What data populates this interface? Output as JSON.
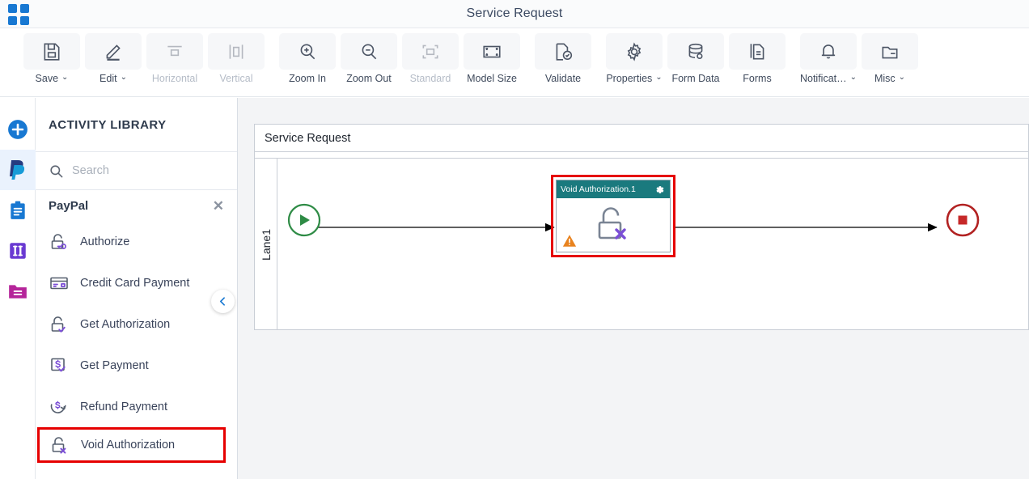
{
  "window": {
    "title": "Service Request",
    "app_icon": "grid-icon"
  },
  "toolbar": {
    "items": [
      {
        "label": "Save",
        "icon": "save-icon",
        "caret": "⌄",
        "disabled": false
      },
      {
        "label": "Edit",
        "icon": "pencil-icon",
        "caret": "⌄",
        "disabled": false
      },
      {
        "label": "Horizontal",
        "icon": "horizontal-icon",
        "caret": "",
        "disabled": true
      },
      {
        "label": "Vertical",
        "icon": "vertical-icon",
        "caret": "",
        "disabled": true
      },
      {
        "label": "Zoom In",
        "icon": "zoom-in-icon",
        "caret": "",
        "disabled": false
      },
      {
        "label": "Zoom Out",
        "icon": "zoom-out-icon",
        "caret": "",
        "disabled": false
      },
      {
        "label": "Standard",
        "icon": "standard-icon",
        "caret": "",
        "disabled": true
      },
      {
        "label": "Model Size",
        "icon": "model-size-icon",
        "caret": "",
        "disabled": false
      },
      {
        "label": "Validate",
        "icon": "validate-icon",
        "caret": "",
        "disabled": false
      },
      {
        "label": "Properties",
        "icon": "gear-icon",
        "caret": "⌄",
        "disabled": false
      },
      {
        "label": "Form Data",
        "icon": "database-icon",
        "caret": "",
        "disabled": false
      },
      {
        "label": "Forms",
        "icon": "document-icon",
        "caret": "",
        "disabled": false
      },
      {
        "label": "Notificat…",
        "icon": "bell-icon",
        "caret": "⌄",
        "disabled": false
      },
      {
        "label": "Misc",
        "icon": "folder-icon",
        "caret": "⌄",
        "disabled": false
      }
    ]
  },
  "rail": {
    "items": [
      {
        "name": "add-button",
        "icon": "plus-circle-icon",
        "active": false
      },
      {
        "name": "paypal-connector",
        "icon": "paypal-icon",
        "active": true
      },
      {
        "name": "clipboard-section",
        "icon": "clipboard-icon",
        "active": false
      },
      {
        "name": "columns-section",
        "icon": "columns-icon",
        "active": false
      },
      {
        "name": "folder-section",
        "icon": "folder-pink-icon",
        "active": false
      }
    ]
  },
  "panel": {
    "heading": "ACTIVITY LIBRARY",
    "search": {
      "value": "",
      "placeholder": "Search",
      "icon": "search-icon"
    },
    "group": {
      "label": "PayPal",
      "close_icon": "close-icon"
    },
    "activities": [
      {
        "label": "Authorize",
        "icon": "lock-key-icon",
        "highlighted": false
      },
      {
        "label": "Credit Card Payment",
        "icon": "credit-card-icon",
        "highlighted": false
      },
      {
        "label": "Get Authorization",
        "icon": "lock-check-icon",
        "highlighted": false
      },
      {
        "label": "Get Payment",
        "icon": "dollar-check-icon",
        "highlighted": false
      },
      {
        "label": "Refund Payment",
        "icon": "dollar-refund-icon",
        "highlighted": false
      },
      {
        "label": "Void Authorization",
        "icon": "lock-x-icon",
        "highlighted": true
      }
    ],
    "collapse_icon": "chevron-left-icon"
  },
  "canvas": {
    "pool_title": "Service Request",
    "lane_label": "Lane1",
    "start_event": {
      "name": "start-event",
      "icon": "play-icon"
    },
    "end_event": {
      "name": "end-event",
      "icon": "stop-icon"
    },
    "task": {
      "title": "Void Authorization.1",
      "gear_icon": "gear-icon",
      "warning_icon": "warning-icon",
      "body_icon": "lock-x-icon"
    }
  },
  "colors": {
    "accent_blue": "#1878d2",
    "task_header_teal": "#1a7a7e",
    "highlight_red": "#e60000",
    "start_green": "#2e8b45",
    "end_red": "#b22222",
    "warning_orange": "#e8821e",
    "icon_purple": "#7b4fd6"
  }
}
